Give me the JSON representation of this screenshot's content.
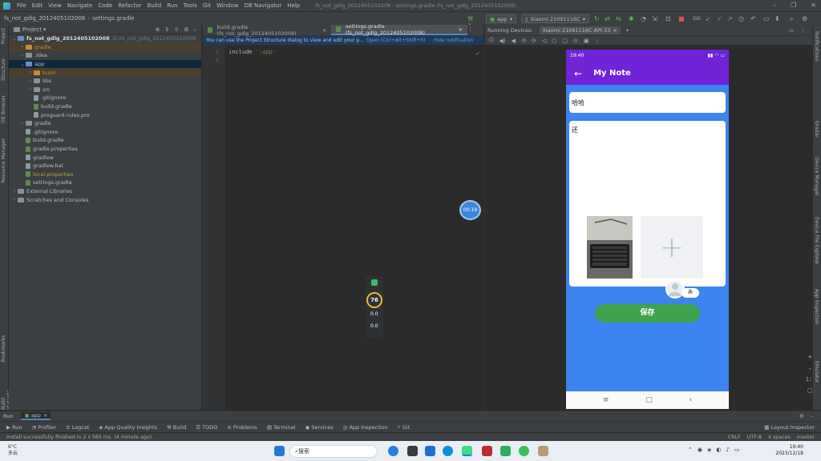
{
  "menu": {
    "items": [
      "File",
      "Edit",
      "View",
      "Navigate",
      "Code",
      "Refactor",
      "Build",
      "Run",
      "Tools",
      "Git",
      "Window",
      "DB Navigator",
      "Help"
    ],
    "window_title": "fs_not_gdlg_2012405102008 - settings.gradle (fs_not_gdlg_2012405102008)"
  },
  "nav": {
    "project": "fs_not_gdlg_2012405102008",
    "file": "settings.gradle",
    "run_config": "app",
    "device": "Xiaomi 21091116C",
    "git_label": "Git:"
  },
  "project_panel": {
    "title": "Project",
    "root": "fs_not_gdlg_2012405102008",
    "root_path": "D:\\fs_not_gdlg_2012405102008",
    "tree": [
      {
        "label": "gradle",
        "indent": 1,
        "kind": "folder-orange",
        "arrow": "›",
        "hl": true
      },
      {
        "label": ".idea",
        "indent": 1,
        "kind": "folder",
        "arrow": "›"
      },
      {
        "label": "app",
        "indent": 1,
        "kind": "folder-blue",
        "arrow": "⌄",
        "sel": true
      },
      {
        "label": "build",
        "indent": 2,
        "kind": "folder-orange",
        "arrow": "›",
        "hl": true
      },
      {
        "label": "libs",
        "indent": 2,
        "kind": "folder",
        "arrow": "›"
      },
      {
        "label": "src",
        "indent": 2,
        "kind": "folder",
        "arrow": "›"
      },
      {
        "label": ".gitignore",
        "indent": 2,
        "kind": "file"
      },
      {
        "label": "build.gradle",
        "indent": 2,
        "kind": "file-g"
      },
      {
        "label": "proguard-rules.pro",
        "indent": 2,
        "kind": "file"
      },
      {
        "label": "gradle",
        "indent": 1,
        "kind": "folder",
        "arrow": "›"
      },
      {
        "label": ".gitignore",
        "indent": 1,
        "kind": "file"
      },
      {
        "label": "build.gradle",
        "indent": 1,
        "kind": "file-g"
      },
      {
        "label": "gradle.properties",
        "indent": 1,
        "kind": "file-g"
      },
      {
        "label": "gradlew",
        "indent": 1,
        "kind": "file"
      },
      {
        "label": "gradlew.bat",
        "indent": 1,
        "kind": "file"
      },
      {
        "label": "local.properties",
        "indent": 1,
        "kind": "file-g",
        "yellow": true
      },
      {
        "label": "settings.gradle",
        "indent": 1,
        "kind": "file-g"
      },
      {
        "label": "External Libraries",
        "indent": 0,
        "kind": "folder",
        "arrow": "›"
      },
      {
        "label": "Scratches and Consoles",
        "indent": 0,
        "kind": "folder",
        "arrow": "›"
      }
    ]
  },
  "left_tools": [
    "Project",
    "Structure",
    "DB Browser",
    "Resource Manager",
    "Bookmarks",
    "Build Variants"
  ],
  "editor": {
    "tabs": [
      "build.gradle (fs_not_gdlg_2012405102008)",
      "settings.gradle (fs_not_gdlg_2012405102008)"
    ],
    "notice": "You can use the Project Structure dialog to view and edit your p...",
    "notice_link1": "Open (Ctrl+Alt+Shift+S)",
    "notice_link2": "Hide notification",
    "line1": "1",
    "line2": "2",
    "code_kw": "include ",
    "code_str": "':app'"
  },
  "run_panel": {
    "title": "Running Devices:",
    "device_tab": "Xiaomi 21091116C API 33"
  },
  "phone": {
    "status_time": "19:40",
    "status_right": "▮▮ ◠ ▭",
    "app_title": "My Note",
    "back": "←",
    "title_value": "哈哈",
    "body_value": "还",
    "add_icon": "+",
    "avatar_label": "典",
    "save": "保存"
  },
  "timer": "00:19",
  "monitor": {
    "score": "76",
    "up": "0.0",
    "down": "0.0"
  },
  "bottom_tabs": [
    "Run",
    "app"
  ],
  "status_tools": [
    "Run",
    "Profiler",
    "Logcat",
    "App Quality Insights",
    "Build",
    "TODO",
    "Problems",
    "Terminal",
    "Services",
    "App Inspection",
    "Git",
    "Layout Inspector"
  ],
  "status_line": "Install successfully finished in 2 s 565 ms. (4 minute ago)",
  "status_right": [
    "CRLF",
    "UTF-8",
    "4 spaces",
    "master"
  ],
  "right_tools": [
    "Notifications",
    "Gradle",
    "Device Manager",
    "Device File Explorer",
    "App Inspection",
    "Emulator"
  ],
  "taskbar": {
    "weather_temp": "6°C",
    "weather_desc": "多云",
    "search": "搜索",
    "time": "19:40",
    "date": "2023/12/18"
  }
}
